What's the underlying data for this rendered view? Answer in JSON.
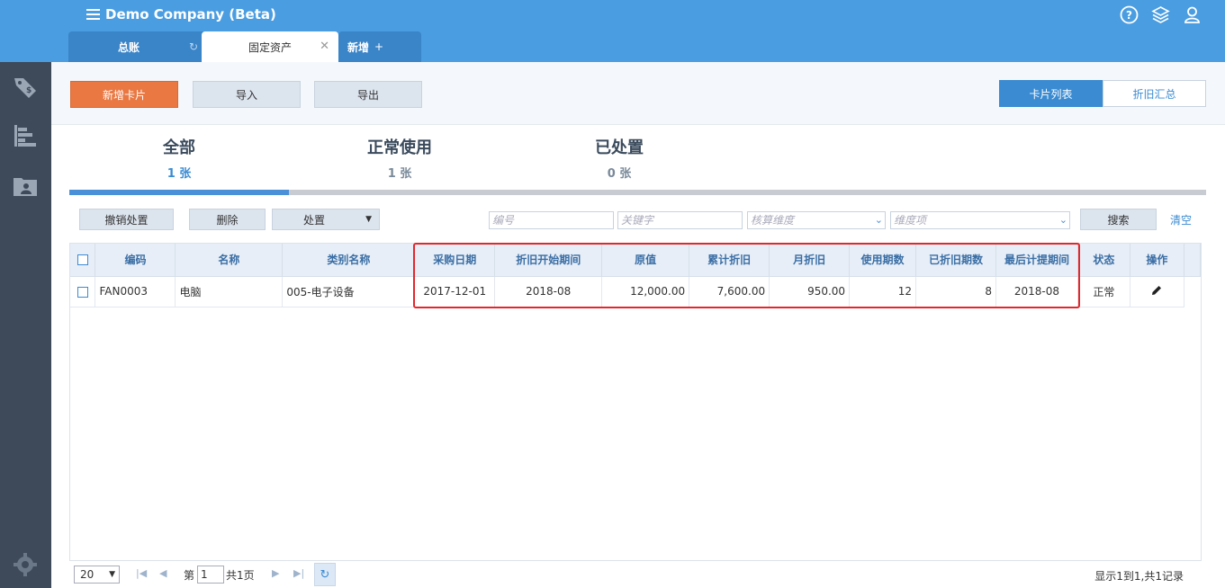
{
  "app": {
    "title": "Demo Company (Beta)"
  },
  "tabs": [
    {
      "label": "总账"
    },
    {
      "label": "固定资产"
    },
    {
      "label": "新增"
    }
  ],
  "toolbar": {
    "add_card": "新增卡片",
    "import": "导入",
    "export": "导出",
    "card_list": "卡片列表",
    "depr_summary": "折旧汇总"
  },
  "summary": [
    {
      "label": "全部",
      "count": "1 张"
    },
    {
      "label": "正常使用",
      "count": "1 张"
    },
    {
      "label": "已处置",
      "count": "0 张"
    }
  ],
  "filters": {
    "undo_dispose": "撤销处置",
    "delete": "删除",
    "dispose": "处置",
    "code_placeholder": "编号",
    "keyword_placeholder": "关键字",
    "dimension_placeholder": "核算维度",
    "dimension_item_placeholder": "维度项",
    "search": "搜索",
    "clear": "清空"
  },
  "grid": {
    "columns": [
      "编码",
      "名称",
      "类别名称",
      "采购日期",
      "折旧开始期间",
      "原值",
      "累计折旧",
      "月折旧",
      "使用期数",
      "已折旧期数",
      "最后计提期间",
      "状态",
      "操作"
    ],
    "rows": [
      {
        "code": "FAN0003",
        "name": "电脑",
        "category": "005-电子设备",
        "purchase_date": "2017-12-01",
        "depr_start": "2018-08",
        "original_value": "12,000.00",
        "accum_depr": "7,600.00",
        "monthly_depr": "950.00",
        "periods": "12",
        "depr_periods": "8",
        "last_period": "2018-08",
        "status": "正常"
      }
    ]
  },
  "pager": {
    "page_size": "20",
    "page_prefix": "第",
    "page": "1",
    "page_total": "共1页",
    "info": "显示1到1,共1记录"
  }
}
